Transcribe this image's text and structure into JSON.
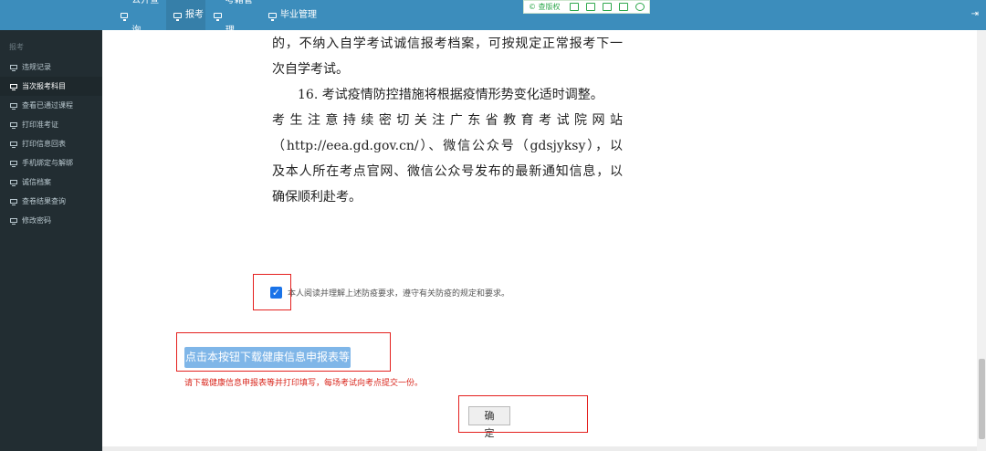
{
  "nav": {
    "items": [
      {
        "label": "公开查询"
      },
      {
        "label": "报考"
      },
      {
        "label": "考籍管理"
      },
      {
        "label": "毕业管理"
      }
    ]
  },
  "toolbar": {
    "copyright": "© 查版权"
  },
  "sidebar": {
    "header": "报考",
    "items": [
      {
        "label": "违规记录"
      },
      {
        "label": "当次报考科目"
      },
      {
        "label": "查看已通过课程"
      },
      {
        "label": "打印准考证"
      },
      {
        "label": "打印信息回表"
      },
      {
        "label": "手机绑定与解绑"
      },
      {
        "label": "诚信档案"
      },
      {
        "label": "查卷结果查询"
      },
      {
        "label": "修改密码"
      }
    ]
  },
  "notice": {
    "line1": "的，不纳入自学考试诚信报考档案，可按规定正常报考下一",
    "line2": "次自学考试。",
    "line3": "16. 考试疫情防控措施将根据疫情形势变化适时调整。",
    "line4": "考生注意持续密切关注广东省教育考试院网站",
    "line5": "（http://eea.gd.gov.cn/）、微信公众号（gdsjyksy），以",
    "line6": "及本人所在考点官网、微信公众号发布的最新通知信息，以",
    "line7": "确保顺利赴考。"
  },
  "agreement": {
    "checked": true,
    "label": "本人阅读并理解上述防疫要求，遵守有关防疫的规定和要求。"
  },
  "download": {
    "button_label": "点击本按钮下载健康信息申报表等",
    "note": "请下载健康信息申报表等并打印填写，每场考试向考点提交一份。"
  },
  "confirm": {
    "button_label": "确 定"
  },
  "colors": {
    "nav_bg": "#3c8dbc",
    "sidebar_bg": "#222d32",
    "highlight_box": "#e4201e",
    "note_text": "#d9261c"
  }
}
